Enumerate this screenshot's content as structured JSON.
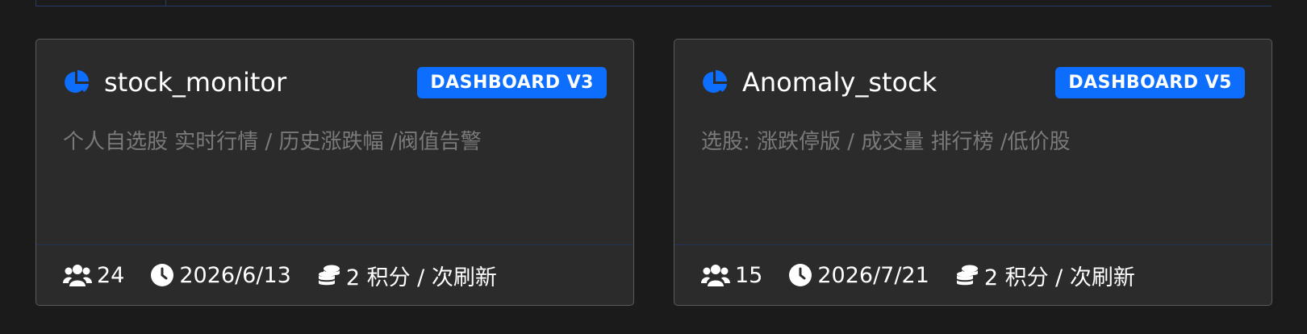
{
  "cards": [
    {
      "icon": "pie-chart-icon",
      "title": "stock_monitor",
      "badge": "DASHBOARD V3",
      "description": "个人自选股 实时行情 / 历史涨跌幅 /阀值告警",
      "users": "24",
      "date": "2026/6/13",
      "cost": "2 积分 / 次刷新"
    },
    {
      "icon": "pie-chart-icon",
      "title": "Anomaly_stock",
      "badge": "DASHBOARD V5",
      "description": "选股: 涨跌停版 / 成交量 排行榜 /低价股",
      "users": "15",
      "date": "2026/7/21",
      "cost": "2 积分 / 次刷新"
    }
  ],
  "colors": {
    "accent": "#0d6efd",
    "background": "#1b1b1b",
    "card": "#2b2b2b",
    "muted_text": "#7a7a7a"
  }
}
